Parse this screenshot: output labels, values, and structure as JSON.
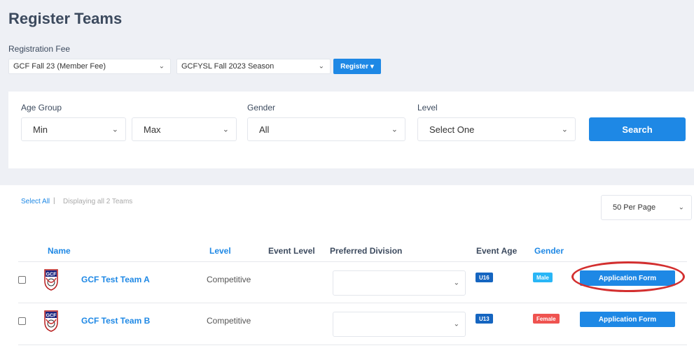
{
  "header": {
    "title": "Register Teams",
    "fee_label": "Registration Fee"
  },
  "fee_select": {
    "value": "GCF Fall 23 (Member Fee)"
  },
  "season_select": {
    "value": "GCFYSL Fall 2023 Season"
  },
  "register_button": {
    "label": "Register ▾"
  },
  "filters": {
    "age_group_label": "Age Group",
    "min_value": "Min",
    "max_value": "Max",
    "gender_label": "Gender",
    "gender_value": "All",
    "level_label": "Level",
    "level_value": "Select One",
    "search_label": "Search"
  },
  "results": {
    "select_all": "Select All",
    "separator": "|",
    "displaying": "Displaying all 2 Teams",
    "per_page": "50 Per Page"
  },
  "table": {
    "headers": {
      "name": "Name",
      "level": "Level",
      "event_level": "Event Level",
      "preferred_division": "Preferred Division",
      "event_age": "Event Age",
      "gender": "Gender"
    },
    "rows": [
      {
        "name": "GCF Test Team A",
        "level": "Competitive",
        "event_age": "U16",
        "gender": "Male",
        "gender_color": "#29b6f6",
        "button": "Application Form",
        "highlighted": true
      },
      {
        "name": "GCF Test Team B",
        "level": "Competitive",
        "event_age": "U13",
        "gender": "Female",
        "gender_color": "#ef5350",
        "button": "Application Form",
        "highlighted": false
      }
    ]
  },
  "colors": {
    "accent": "#1e88e5",
    "highlight": "#d32f2f",
    "background": "#eef0f5"
  },
  "icons": {
    "chevron": "chevron-down-icon",
    "logo": "gcf-logo-icon"
  }
}
